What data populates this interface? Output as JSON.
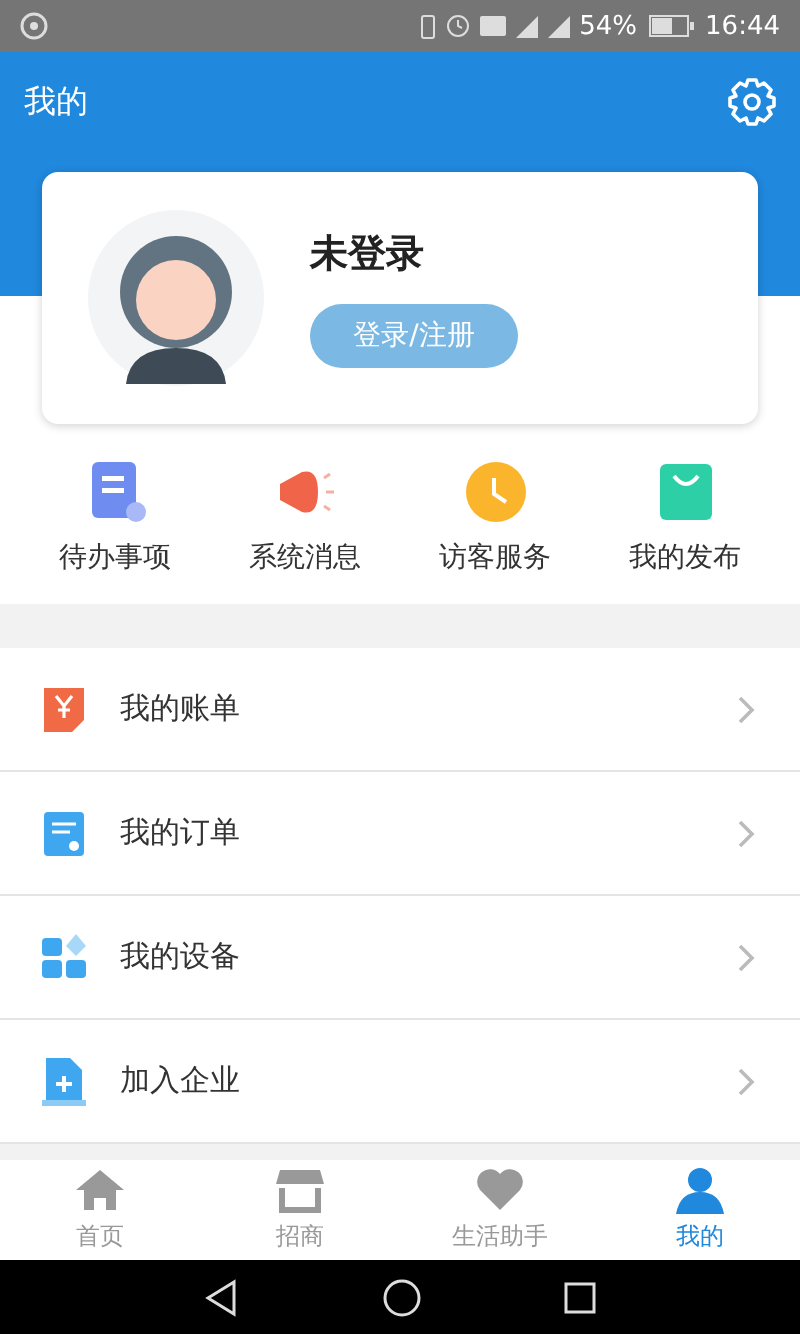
{
  "status_bar": {
    "battery": "54%",
    "time": "16:44"
  },
  "header": {
    "title": "我的"
  },
  "profile": {
    "name": "未登录",
    "login_button": "登录/注册"
  },
  "shortcuts": [
    {
      "label": "待办事项",
      "kind": "todo"
    },
    {
      "label": "系统消息",
      "kind": "speaker"
    },
    {
      "label": "访客服务",
      "kind": "clock"
    },
    {
      "label": "我的发布",
      "kind": "bag"
    }
  ],
  "menu": [
    {
      "label": "我的账单",
      "kind": "bill"
    },
    {
      "label": "我的订单",
      "kind": "order"
    },
    {
      "label": "我的设备",
      "kind": "device"
    },
    {
      "label": "加入企业",
      "kind": "join"
    }
  ],
  "tabs": [
    {
      "label": "首页",
      "kind": "home",
      "selected": false
    },
    {
      "label": "招商",
      "kind": "store",
      "selected": false
    },
    {
      "label": "生活助手",
      "kind": "heart",
      "selected": false
    },
    {
      "label": "我的",
      "kind": "user",
      "selected": true
    }
  ]
}
